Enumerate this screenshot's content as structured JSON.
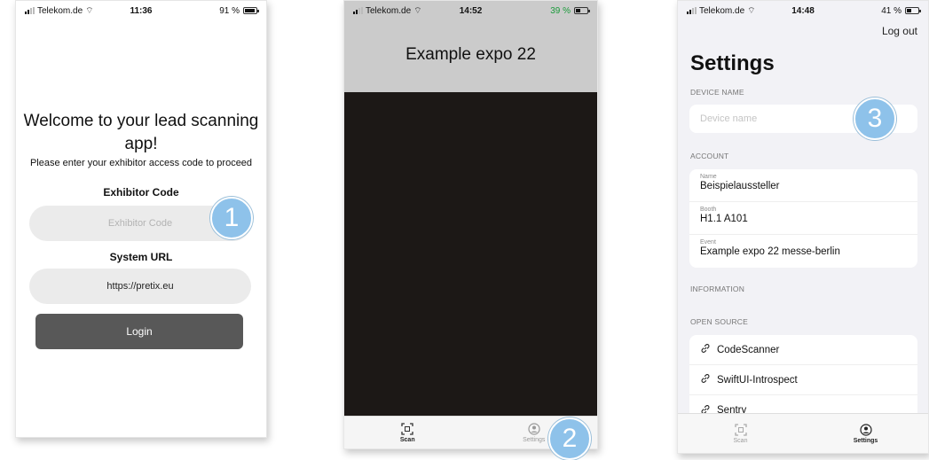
{
  "phones": [
    {
      "status": {
        "carrier": "Telekom.de",
        "time": "11:36",
        "battery": "91 %"
      },
      "welcome_title": "Welcome to your lead scanning app!",
      "welcome_subtitle": "Please enter your exhibitor access code to proceed",
      "exhibitor_label": "Exhibitor Code",
      "exhibitor_placeholder": "Exhibitor Code",
      "url_label": "System URL",
      "url_value": "https://pretix.eu",
      "login_label": "Login"
    },
    {
      "status": {
        "carrier": "Telekom.de",
        "time": "14:52",
        "battery": "39 %"
      },
      "event_title": "Example expo 22",
      "tabs": [
        {
          "label": "Scan"
        },
        {
          "label": "Settings"
        }
      ]
    },
    {
      "status": {
        "carrier": "Telekom.de",
        "time": "14:48",
        "battery": "41 %"
      },
      "logout_label": "Log out",
      "title": "Settings",
      "device_section": "DEVICE NAME",
      "device_placeholder": "Device name",
      "account_section": "ACCOUNT",
      "account": [
        {
          "key": "Name",
          "value": "Beispielaussteller"
        },
        {
          "key": "Booth",
          "value": "H1.1 A101"
        },
        {
          "key": "Event",
          "value": "Example expo 22 messe-berlin"
        }
      ],
      "information_section": "INFORMATION",
      "opensource_section": "OPEN SOURCE",
      "links": [
        {
          "label": "CodeScanner"
        },
        {
          "label": "SwiftUI-Introspect"
        },
        {
          "label": "Sentry"
        }
      ],
      "tabs": [
        {
          "label": "Scan"
        },
        {
          "label": "Settings"
        }
      ]
    }
  ],
  "callouts": [
    "1",
    "2",
    "3"
  ],
  "colors": {
    "callout": "#8ec2ea",
    "login_button": "#585858",
    "camera": "#1c1816",
    "header_gray": "#cbcbcb"
  }
}
